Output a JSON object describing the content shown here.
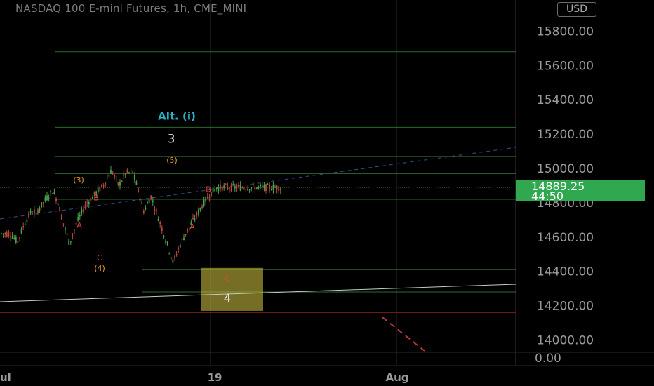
{
  "header": {
    "title": "NASDAQ 100 E-mini Futures, 1h, CME_MINI",
    "currency_button": "USD"
  },
  "price_tag": {
    "price": "14889.25",
    "countdown": "44:50"
  },
  "colors": {
    "background": "#000000",
    "price_tag": "#2fa84f",
    "candle": "#49a34b",
    "candle_down": "#c0453f",
    "wave_label_orange": "#f0a12e",
    "wave_label_red": "#e0483f",
    "alt_label": "#29b3c8",
    "zone": "#bfb23a",
    "level_green": "#2a6b2a",
    "level_red": "#7a1f1f"
  },
  "chart_data": {
    "type": "candlestick",
    "title": "NASDAQ 100 E-mini Futures, 1h, CME_MINI",
    "y_axis": {
      "ticks": [
        15800,
        15600,
        15400,
        15200,
        15000,
        14800,
        14600,
        14400,
        14200,
        14000
      ],
      "tick_labels": [
        "15800.00",
        "15600.00",
        "15400.00",
        "15200.00",
        "15000.00",
        "14800.00",
        "14600.00",
        "14400.00",
        "14200.00",
        "14000.00"
      ],
      "extra_label": "0.00",
      "range": [
        13900,
        15960
      ]
    },
    "x_axis": {
      "tick_labels": [
        "ul",
        "19",
        "Aug"
      ]
    },
    "last_price": 14889.25,
    "price_series": [
      [
        0,
        14620
      ],
      [
        0.05,
        14570
      ],
      [
        0.1,
        14680
      ],
      [
        0.14,
        14740
      ],
      [
        0.2,
        14760
      ],
      [
        0.26,
        14830
      ],
      [
        0.3,
        14870
      ],
      [
        0.34,
        14800
      ],
      [
        0.37,
        14700
      ],
      [
        0.42,
        14560
      ],
      [
        0.47,
        14680
      ],
      [
        0.53,
        14780
      ],
      [
        0.6,
        14850
      ],
      [
        0.66,
        14900
      ],
      [
        0.72,
        14990
      ],
      [
        0.77,
        14900
      ],
      [
        0.82,
        14970
      ],
      [
        0.87,
        14980
      ],
      [
        0.9,
        14900
      ],
      [
        0.95,
        14750
      ],
      [
        1.0,
        14840
      ],
      [
        1.05,
        14720
      ],
      [
        1.1,
        14600
      ],
      [
        1.16,
        14450
      ],
      [
        1.2,
        14540
      ],
      [
        1.26,
        14640
      ],
      [
        1.32,
        14720
      ],
      [
        1.37,
        14790
      ],
      [
        1.42,
        14850
      ],
      [
        1.47,
        14889.25
      ]
    ],
    "horizontal_levels": [
      {
        "price": 15680,
        "color": "green"
      },
      {
        "price": 15240,
        "color": "green"
      },
      {
        "price": 15070,
        "color": "green"
      },
      {
        "price": 14970,
        "color": "green"
      },
      {
        "price": 14820,
        "color": "green"
      },
      {
        "price": 14410,
        "color": "green"
      },
      {
        "price": 14280,
        "color": "green"
      },
      {
        "price": 14160,
        "color": "red"
      }
    ],
    "target_zone": {
      "price_top": 14420,
      "price_bottom": 14170
    },
    "wave_labels": [
      {
        "text": "Alt. (i)",
        "price": 15300,
        "color": "cyan"
      },
      {
        "text": "3",
        "price": 15165,
        "color": "white"
      },
      {
        "text": "(5)",
        "price": 15050,
        "color": "orange"
      },
      {
        "text": "(3)",
        "price": 14935,
        "color": "orange"
      },
      {
        "text": "B",
        "price": 14830,
        "color": "red"
      },
      {
        "text": "B",
        "price": 14880,
        "color": "red"
      },
      {
        "text": "A",
        "price": 14670,
        "color": "red"
      },
      {
        "text": "A",
        "price": 14660,
        "color": "red"
      },
      {
        "text": "C",
        "price": 14480,
        "color": "red"
      },
      {
        "text": "(4)",
        "price": 14420,
        "color": "orange"
      },
      {
        "text": "C",
        "price": 14360,
        "color": "red"
      },
      {
        "text": "4",
        "price": 14235,
        "color": "white"
      }
    ]
  }
}
